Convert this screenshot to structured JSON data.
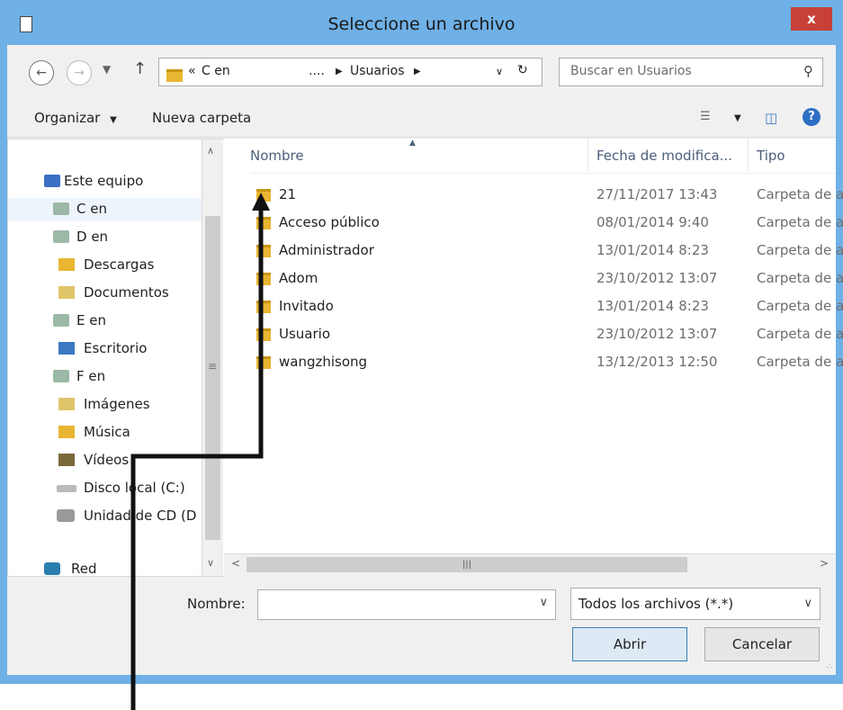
{
  "window": {
    "title": "Seleccione un archivo",
    "close_label": "x"
  },
  "nav": {
    "back_icon": "back-arrow-icon",
    "forward_icon": "forward-arrow-icon",
    "up_icon": "up-arrow-icon",
    "breadcrumb": {
      "prefix": "«",
      "drive": "C en",
      "ellipsis": "....",
      "folder": "Usuarios"
    },
    "search_placeholder": "Buscar en Usuarios"
  },
  "toolbar": {
    "organize_label": "Organizar",
    "new_folder_label": "Nueva carpeta",
    "help_label": "?"
  },
  "sidebar": {
    "items": [
      {
        "label": "Este equipo",
        "icon": "computer-icon"
      },
      {
        "label": "C en",
        "icon": "network-drive-icon"
      },
      {
        "label": "D en",
        "icon": "network-drive-icon"
      },
      {
        "label": "Descargas",
        "icon": "downloads-icon"
      },
      {
        "label": "Documentos",
        "icon": "documents-icon"
      },
      {
        "label": "E en",
        "icon": "network-drive-icon"
      },
      {
        "label": "Escritorio",
        "icon": "desktop-icon"
      },
      {
        "label": "F en",
        "icon": "network-drive-icon"
      },
      {
        "label": "Imágenes",
        "icon": "pictures-icon"
      },
      {
        "label": "Música",
        "icon": "music-icon"
      },
      {
        "label": "Vídeos",
        "icon": "videos-icon"
      },
      {
        "label": "Disco local (C:)",
        "icon": "hard-disk-icon"
      },
      {
        "label": "Unidad de CD (D",
        "icon": "cd-drive-icon"
      },
      {
        "label": "Red",
        "icon": "network-icon"
      }
    ]
  },
  "files": {
    "columns": {
      "name": "Nombre",
      "date": "Fecha de modifica...",
      "type": "Tipo"
    },
    "rows": [
      {
        "name": "21",
        "date": "27/11/2017 13:43",
        "type": "Carpeta de a"
      },
      {
        "name": "Acceso público",
        "date": "08/01/2014 9:40",
        "type": "Carpeta de a"
      },
      {
        "name": "Administrador",
        "date": "13/01/2014 8:23",
        "type": "Carpeta de a"
      },
      {
        "name": "Adom",
        "date": "23/10/2012 13:07",
        "type": "Carpeta de a"
      },
      {
        "name": "Invitado",
        "date": "13/01/2014 8:23",
        "type": "Carpeta de a"
      },
      {
        "name": "Usuario",
        "date": "23/10/2012 13:07",
        "type": "Carpeta de a"
      },
      {
        "name": "wangzhisong",
        "date": "13/12/2013 12:50",
        "type": "Carpeta de a"
      }
    ]
  },
  "bottom": {
    "name_label": "Nombre:",
    "name_value": "",
    "filter_value": "Todos los archivos (*.*)",
    "open_label": "Abrir",
    "cancel_label": "Cancelar"
  },
  "colors": {
    "frame": "#6fb0e6",
    "close": "#c7413a",
    "folder": "#e8b632"
  }
}
